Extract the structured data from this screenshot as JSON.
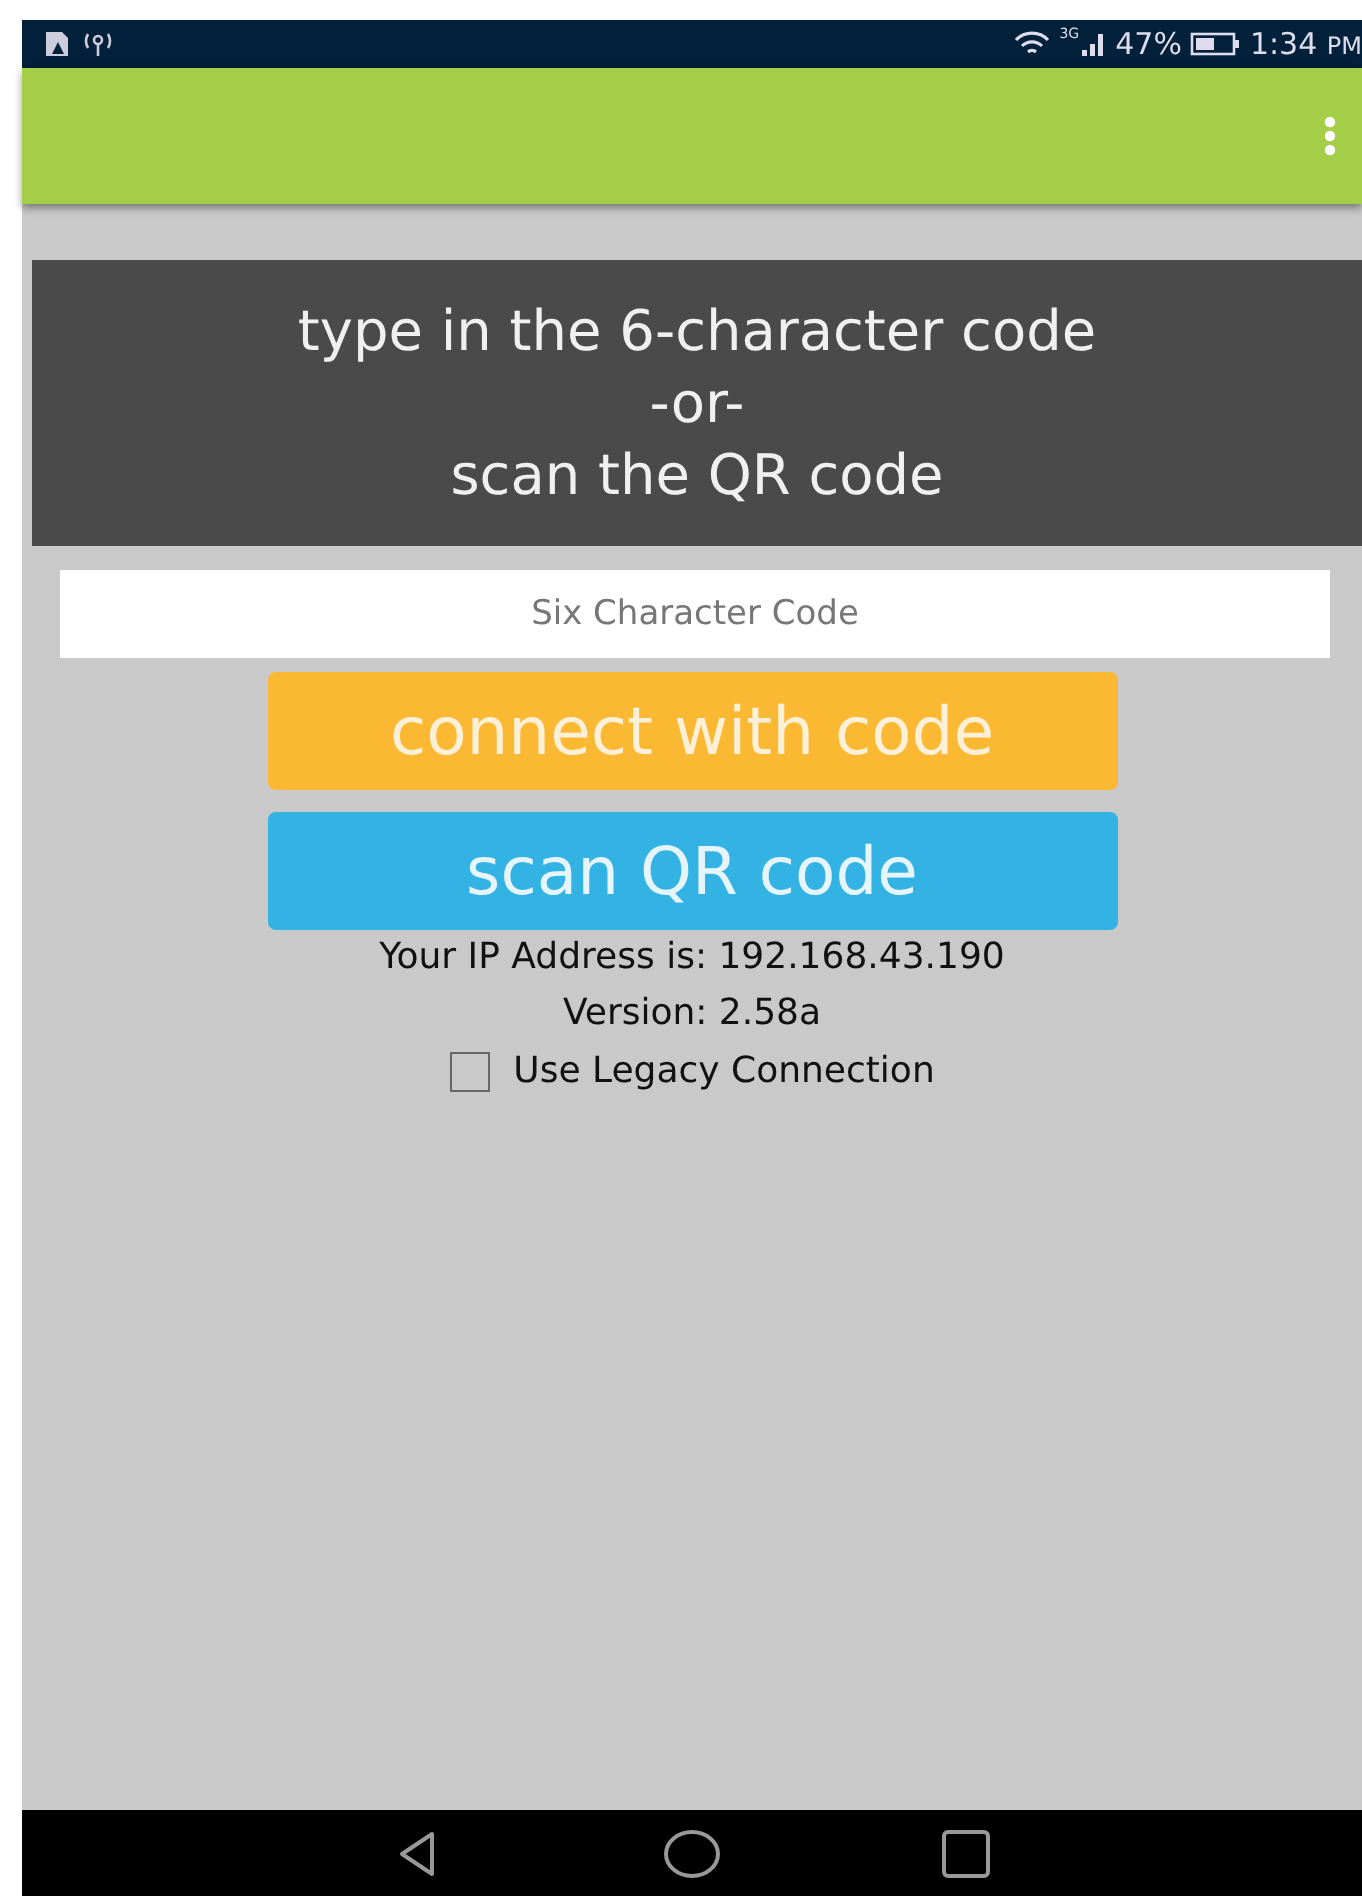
{
  "status_bar": {
    "battery_percent": "47%",
    "network": "3G",
    "time": "1:34",
    "time_suffix": "PM"
  },
  "instructions": [
    "type in the 6-character code",
    "-or-",
    "scan the QR code"
  ],
  "code_field": {
    "placeholder": "Six Character Code"
  },
  "buttons": [
    {
      "kind": "connect",
      "label": "connect with code"
    },
    {
      "kind": "scan",
      "label": "scan QR code"
    }
  ],
  "ip_text": "Your IP Address is: 192.168.43.190",
  "version_text": "Version: 2.58a",
  "legacy_checkbox": {
    "label": "Use Legacy Connection",
    "checked": false
  }
}
